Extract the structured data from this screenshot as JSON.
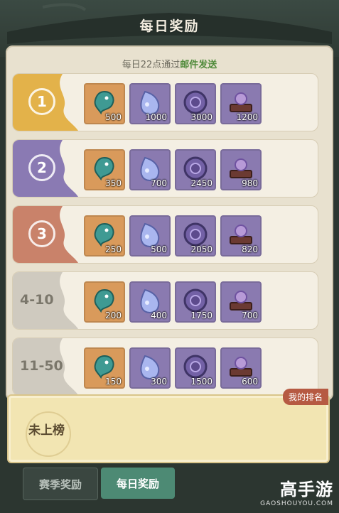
{
  "header": {
    "title": "每日奖励"
  },
  "notice": {
    "prefix": "每日22点通过",
    "highlight": "邮件发送"
  },
  "rows": [
    {
      "rank": "1",
      "color": "#e3b24a",
      "items": [
        "500",
        "1000",
        "3000",
        "1200"
      ]
    },
    {
      "rank": "2",
      "color": "#8a7ab3",
      "items": [
        "350",
        "700",
        "2450",
        "980"
      ]
    },
    {
      "rank": "3",
      "color": "#c9826a",
      "items": [
        "250",
        "500",
        "2050",
        "820"
      ]
    },
    {
      "rank": "4-10",
      "color": "#cfcabf",
      "items": [
        "200",
        "400",
        "1750",
        "700"
      ]
    },
    {
      "rank": "11-50",
      "color": "#cfcabf",
      "items": [
        "150",
        "300",
        "1500",
        "600"
      ]
    }
  ],
  "item_icons": [
    "teal-spirit-icon",
    "blue-droplet-icon",
    "dragon-medallion-icon",
    "pearl-stand-icon"
  ],
  "my_rank": {
    "tag": "我的排名",
    "value": "未上榜"
  },
  "tabs": {
    "season": "赛季奖励",
    "daily": "每日奖励"
  },
  "watermark": {
    "brand": "高手游",
    "url": "GAOSHOUYOU.COM"
  }
}
